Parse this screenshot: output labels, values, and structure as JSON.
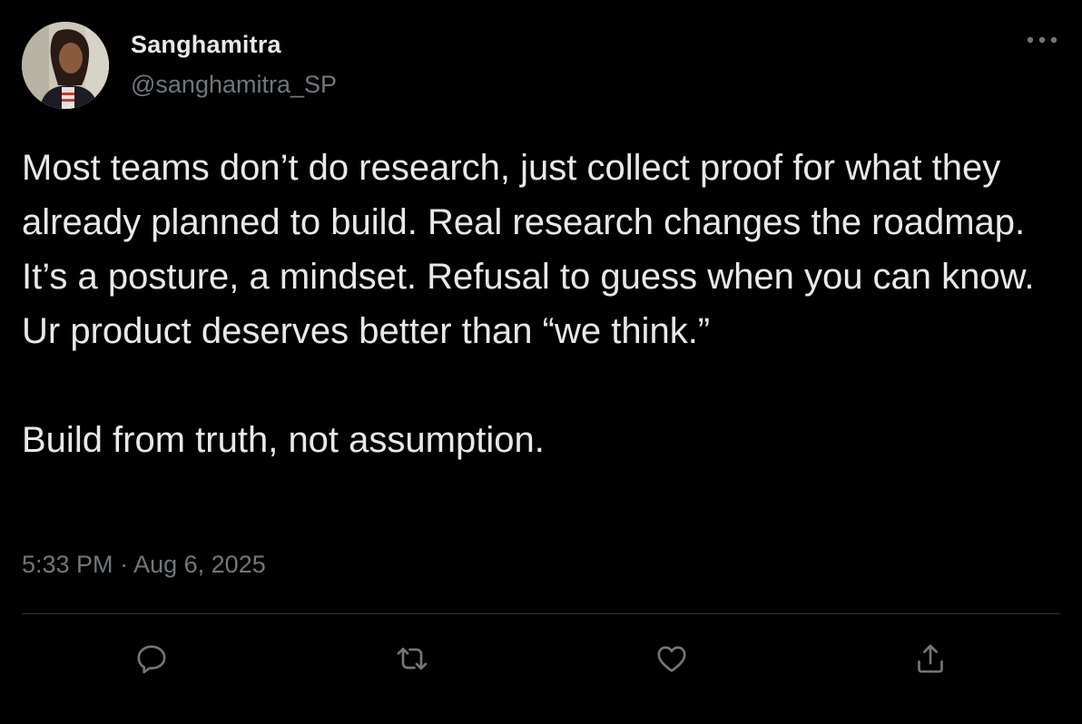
{
  "author": {
    "name": "Sanghamitra",
    "handle": "@sanghamitra_SP"
  },
  "tweet": {
    "paragraph_1": "Most teams don’t do research, just collect proof for what they already planned to build. Real research changes the roadmap. It’s a posture, a mindset. Refusal to guess when you can know. Ur product deserves better than “we think.”",
    "paragraph_2": "Build from truth, not assumption.",
    "time": "5:33 PM",
    "separator": "·",
    "date": "Aug 6, 2025"
  },
  "actions": {
    "icons": [
      "reply-icon",
      "retweet-icon",
      "like-icon",
      "share-icon"
    ]
  },
  "colors": {
    "background": "#000000",
    "primary_text": "#e7e9ea",
    "secondary_text": "#71767b",
    "divider": "#2f3336"
  }
}
